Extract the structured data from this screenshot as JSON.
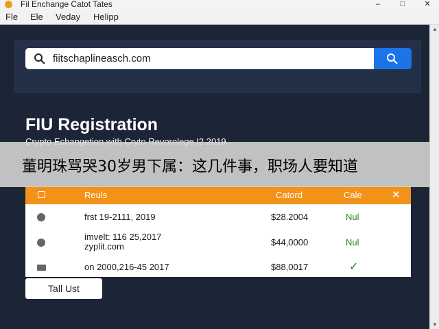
{
  "window": {
    "title": "Fil Enchange Catot Tates",
    "app_icon": "app-logo-icon",
    "controls": {
      "minimize": "–",
      "maximize": "□",
      "close": "✕"
    }
  },
  "menu": [
    "Fle",
    "Ele",
    "Veday",
    "Helipp"
  ],
  "search": {
    "value": "fiitschaplineasch.com",
    "icon": "search-icon",
    "button_icon": "search-icon"
  },
  "page": {
    "title": "FIU Registration",
    "subtitle": "Crypto Echangetion with Cryto Revorolege I2 2019"
  },
  "overlay": {
    "text": "董明珠骂哭30岁男下属：这几件事，职场人要知道"
  },
  "table": {
    "header": {
      "results": "Reuls",
      "catord": "Catord",
      "cale": "Cale",
      "close": "✕"
    },
    "rows": [
      {
        "icon": "circle-icon",
        "name": "frst 19-2111, 2019",
        "amount": "$28.2004",
        "status": "Nul"
      },
      {
        "icon": "info-icon",
        "name": "imvelt: 116 25,2017",
        "name_sub": "zyplit.com",
        "amount": "$44,0000",
        "status": "Nul"
      },
      {
        "icon": "card-icon",
        "name": "on 2000,216-45 2017",
        "amount": "$88,0017",
        "status": "✓"
      }
    ]
  },
  "colors": {
    "background": "#1b2536",
    "panel": "#243047",
    "accent_orange": "#f39218",
    "accent_blue": "#1b74e8",
    "status_green": "#1f8a1f"
  },
  "actions": {
    "tall_button": "Tall Ust"
  }
}
